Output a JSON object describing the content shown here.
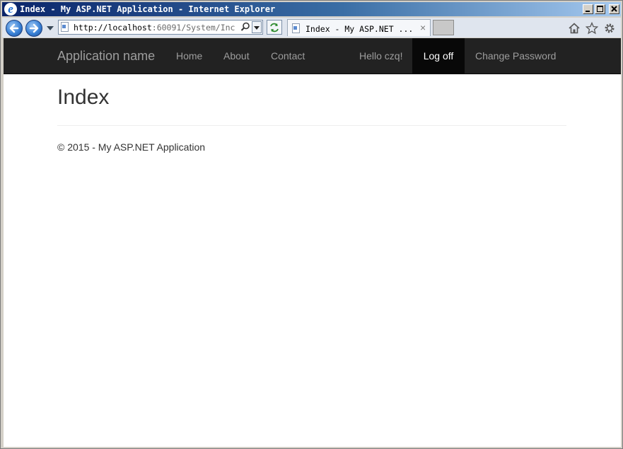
{
  "window": {
    "title": "Index - My ASP.NET Application - Internet Explorer"
  },
  "browser": {
    "address": {
      "host_part": "http://localhost",
      "rest_part": ":60091/System/Inc"
    },
    "tab": {
      "title": "Index - My ASP.NET ...",
      "close_glyph": "×"
    },
    "icons": [
      "back-icon",
      "forward-icon",
      "home-icon",
      "star-icon",
      "gear-icon",
      "search-icon",
      "refresh-icon"
    ]
  },
  "site": {
    "brand": "Application name",
    "nav": {
      "home": "Home",
      "about": "About",
      "contact": "Contact",
      "hello": "Hello czq!",
      "logoff": "Log off",
      "change_password": "Change Password"
    },
    "heading": "Index",
    "footer": "© 2015 - My ASP.NET Application"
  },
  "colors": {
    "navbar_bg": "#222222",
    "nav_link": "#9d9d9d",
    "nav_active_bg": "#080808",
    "text": "#333333"
  }
}
